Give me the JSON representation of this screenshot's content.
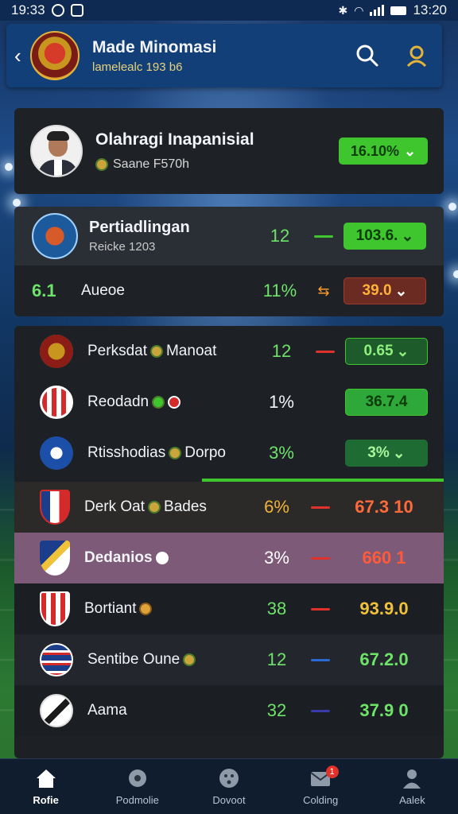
{
  "status_bar": {
    "time_left": "19:33",
    "time_right": "13:20"
  },
  "header": {
    "title": "Made Minomasi",
    "subtitle": "lamelealc 193 b6"
  },
  "profile": {
    "name": "Olahragi Inapanisial",
    "subtitle": "Saane F570h",
    "pill_value": "16.10%"
  },
  "section1": {
    "team": {
      "name": "Pertiadlingan",
      "sub": "Reicke 1203",
      "number": "12",
      "value": "103.6."
    },
    "row2": {
      "rank": "6.1",
      "name": "Aueoe",
      "percent": "11%",
      "value": "39.0"
    }
  },
  "teams": [
    {
      "name": "Perksdat",
      "extra": "Manoat",
      "number": "12",
      "score": "0.65"
    },
    {
      "name": "Reodadn",
      "extra": "",
      "number": "1%",
      "score": "36.7.4"
    },
    {
      "name": "Rtisshodias",
      "extra": "Dorpo",
      "number": "3%",
      "score": "3%"
    },
    {
      "name": "Derk Oat",
      "extra": "Bades",
      "number": "6%",
      "score": "67.3 10"
    },
    {
      "name": "Dedanios",
      "extra": "",
      "number": "3%",
      "score": "660 1"
    },
    {
      "name": "Bortiant",
      "extra": "",
      "number": "38",
      "score": "93.9.0"
    },
    {
      "name": "Sentibe Oune",
      "extra": "",
      "number": "12",
      "score": "67.2.0"
    },
    {
      "name": "Aama",
      "extra": "",
      "number": "32",
      "score": "37.9 0"
    }
  ],
  "tabs": [
    {
      "label": "Rofie",
      "icon": "home-icon"
    },
    {
      "label": "Podmolie",
      "icon": "ball-icon"
    },
    {
      "label": "Dovoot",
      "icon": "face-icon"
    },
    {
      "label": "Colding",
      "icon": "mail-icon",
      "badge": "1"
    },
    {
      "label": "Aalek",
      "icon": "person-icon"
    }
  ],
  "colors": {
    "accent_green": "#3fc62f",
    "header_blue": "#123f78",
    "highlight_row": "#7d5a78",
    "accent_red": "#e0322a"
  }
}
